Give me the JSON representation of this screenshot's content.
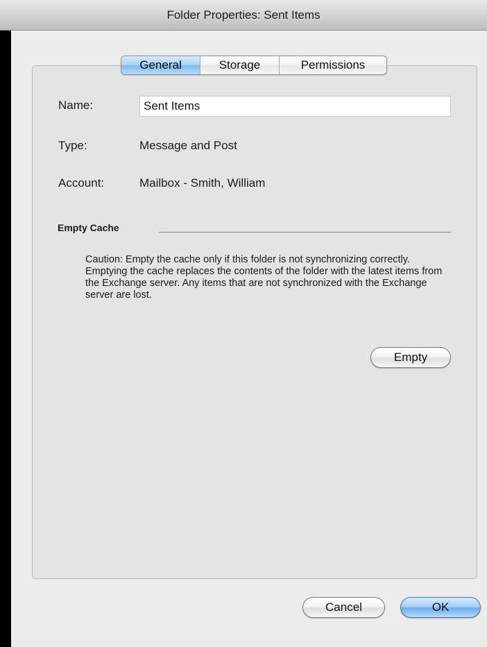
{
  "window": {
    "title": "Folder Properties: Sent Items"
  },
  "tabs": [
    {
      "label": "General",
      "active": true
    },
    {
      "label": "Storage",
      "active": false
    },
    {
      "label": "Permissions",
      "active": false
    }
  ],
  "general": {
    "name_label": "Name:",
    "name_value": "Sent Items",
    "type_label": "Type:",
    "type_value": "Message and Post",
    "account_label": "Account:",
    "account_value": "Mailbox - Smith, William"
  },
  "empty_cache": {
    "title": "Empty Cache",
    "caution": "Caution: Empty the cache only if this folder is not synchronizing correctly. Emptying the cache replaces the contents of the folder with the latest items from the Exchange server. Any items that are not synchronized with the Exchange server are lost.",
    "button_label": "Empty"
  },
  "footer": {
    "cancel_label": "Cancel",
    "ok_label": "OK"
  },
  "colors": {
    "active_tab": "#a9d2f6",
    "default_button": "#6faeea",
    "dialog_background": "#ececec",
    "panel_background": "#e4e4e4"
  }
}
